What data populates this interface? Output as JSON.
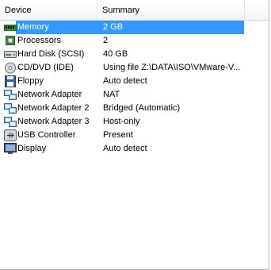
{
  "columns": {
    "device": "Device",
    "summary": "Summary"
  },
  "devices": [
    {
      "name": "Memory",
      "summary": "2 GB",
      "icon": "memory-icon",
      "selected": true
    },
    {
      "name": "Processors",
      "summary": "2",
      "icon": "processor-icon",
      "selected": false
    },
    {
      "name": "Hard Disk (SCSI)",
      "summary": "40 GB",
      "icon": "hard-disk-icon",
      "selected": false
    },
    {
      "name": "CD/DVD (IDE)",
      "summary": "Using file Z:\\DATA\\ISO\\VMware-V...",
      "icon": "cd-dvd-icon",
      "selected": false
    },
    {
      "name": "Floppy",
      "summary": "Auto detect",
      "icon": "floppy-icon",
      "selected": false
    },
    {
      "name": "Network Adapter",
      "summary": "NAT",
      "icon": "network-adapter-icon",
      "selected": false
    },
    {
      "name": "Network Adapter 2",
      "summary": "Bridged (Automatic)",
      "icon": "network-adapter-icon",
      "selected": false
    },
    {
      "name": "Network Adapter 3",
      "summary": "Host-only",
      "icon": "network-adapter-icon",
      "selected": false
    },
    {
      "name": "USB Controller",
      "summary": "Present",
      "icon": "usb-controller-icon",
      "selected": false
    },
    {
      "name": "Display",
      "summary": "Auto detect",
      "icon": "display-icon",
      "selected": false
    }
  ],
  "colors": {
    "selection": "#3399ff"
  }
}
